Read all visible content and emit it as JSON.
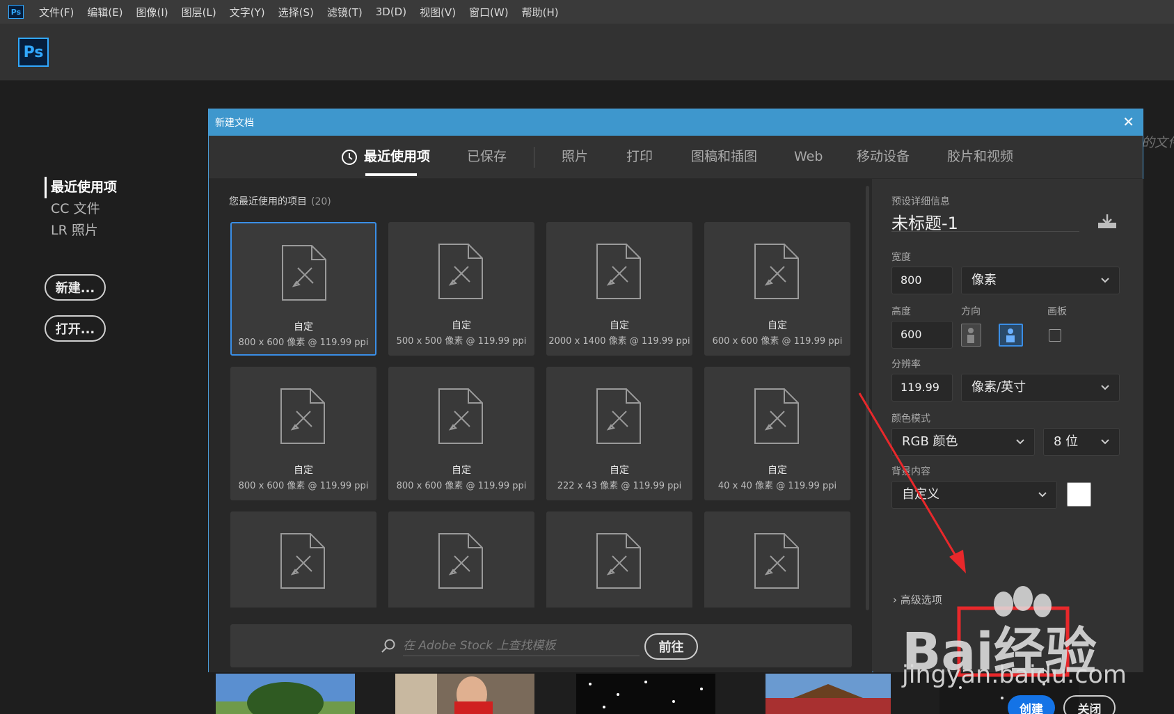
{
  "app": {
    "mini_icon": "Ps",
    "logo": "Ps"
  },
  "menu": [
    "文件(F)",
    "编辑(E)",
    "图像(I)",
    "图层(L)",
    "文字(Y)",
    "选择(S)",
    "滤镜(T)",
    "3D(D)",
    "视图(V)",
    "窗口(W)",
    "帮助(H)"
  ],
  "start": {
    "nav": [
      "最近使用项",
      "CC 文件",
      "LR 照片"
    ],
    "new_button": "新建...",
    "open_button": "打开...",
    "bg_text": "的文件"
  },
  "dialog": {
    "title": "新建文档",
    "close_glyph": "✕",
    "tabs": [
      "最近使用项",
      "已保存",
      "照片",
      "打印",
      "图稿和插图",
      "Web",
      "移动设备",
      "胶片和视频"
    ],
    "section_title": "您最近使用的项目",
    "section_count": "(20)",
    "cards": [
      {
        "name": "自定",
        "dims": "800 x 600 像素 @ 119.99 ppi"
      },
      {
        "name": "自定",
        "dims": "500 x 500 像素 @ 119.99 ppi"
      },
      {
        "name": "自定",
        "dims": "2000 x 1400 像素 @ 119.99 ppi"
      },
      {
        "name": "自定",
        "dims": "600 x 600 像素 @ 119.99 ppi"
      },
      {
        "name": "自定",
        "dims": "800 x 600 像素 @ 119.99 ppi"
      },
      {
        "name": "自定",
        "dims": "800 x 600 像素 @ 119.99 ppi"
      },
      {
        "name": "自定",
        "dims": "222 x 43 像素 @ 119.99 ppi"
      },
      {
        "name": "自定",
        "dims": "40 x 40 像素 @ 119.99 ppi"
      }
    ],
    "stock_placeholder": "在 Adobe Stock 上查找模板",
    "goto_button": "前往",
    "details": {
      "header": "预设详细信息",
      "doc_name": "未标题-1",
      "width_label": "宽度",
      "width_value": "800",
      "width_unit": "像素",
      "height_label": "高度",
      "height_value": "600",
      "orientation_label": "方向",
      "artboard_label": "画板",
      "resolution_label": "分辨率",
      "resolution_value": "119.99",
      "resolution_unit": "像素/英寸",
      "color_mode_label": "颜色模式",
      "color_mode": "RGB 颜色",
      "bit_depth": "8 位",
      "background_label": "背景内容",
      "background_value": "自定义",
      "advanced": "高级选项",
      "create_button": "创建",
      "close_button": "关闭"
    }
  },
  "watermark": {
    "logo": "Bai经验",
    "url": "jingyan.baidu.com"
  },
  "colors": {
    "accent": "#1473e6",
    "titlebar": "#3e97cd",
    "annotation": "#e8282b"
  }
}
